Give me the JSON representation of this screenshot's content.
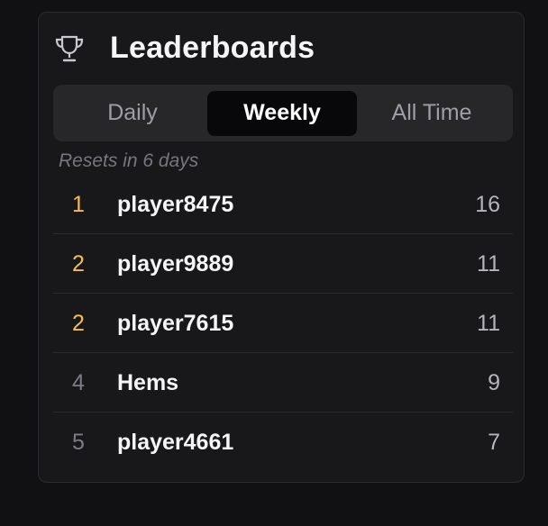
{
  "header": {
    "title": "Leaderboards",
    "icon": "trophy-icon"
  },
  "tabs": [
    {
      "label": "Daily",
      "active": false
    },
    {
      "label": "Weekly",
      "active": true
    },
    {
      "label": "All Time",
      "active": false
    }
  ],
  "reset_note": "Resets in 6 days",
  "leaderboard": [
    {
      "rank": "1",
      "name": "player8475",
      "score": "16"
    },
    {
      "rank": "2",
      "name": "player9889",
      "score": "11"
    },
    {
      "rank": "2",
      "name": "player7615",
      "score": "11"
    },
    {
      "rank": "4",
      "name": "Hems",
      "score": "9"
    },
    {
      "rank": "5",
      "name": "player4661",
      "score": "7"
    }
  ],
  "colors": {
    "background": "#111113",
    "panel": "#18181b",
    "top_rank": "#f4be4f",
    "normal_rank": "#7c7c84",
    "active_tab": "#08080a"
  }
}
